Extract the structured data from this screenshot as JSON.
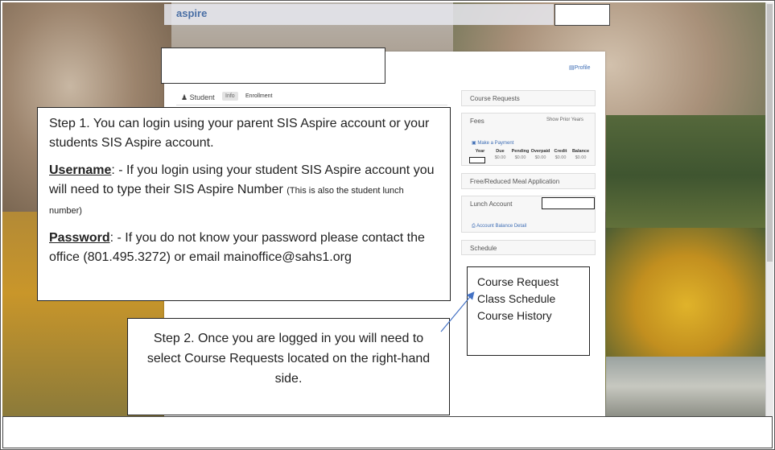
{
  "app": {
    "logo": "aspire",
    "profile_link": "Profile"
  },
  "tabs": {
    "student": "Student",
    "info": "Info",
    "enrollment": "Enrollment"
  },
  "sidebar": {
    "course_requests": "Course Requests",
    "fees": {
      "label": "Fees",
      "show_prior": "Show Prior Years",
      "make_payment": "Make a Payment",
      "columns": [
        "Year",
        "Due",
        "Pending",
        "Overpaid",
        "Credit",
        "Balance"
      ],
      "values": [
        "",
        "$0.00",
        "$0.00",
        "$0.00",
        "$0.00",
        "$0.00"
      ]
    },
    "meal_application": "Free/Reduced Meal Application",
    "lunch_account": {
      "label": "Lunch Account",
      "detail_link": "Account Balance Detail"
    },
    "schedule": "Schedule"
  },
  "step1": {
    "intro": "Step 1. You can login using your parent SIS Aspire account or your students SIS Aspire account.",
    "username_label": "Username",
    "username_text": ": - If you login using your student SIS Aspire account you will need to type their SIS Aspire Number",
    "username_note": "(This is also the student lunch number)",
    "password_label": "Password",
    "password_text": ": - If you do not know your password please contact the office (801.495.3272) or email mainoffice@sahs1.org"
  },
  "step2": {
    "text": "Step 2. Once you are logged in you will need to select Course Requests located on the right-hand side."
  },
  "options_list": [
    "Course Request",
    "Class Schedule",
    "Course History"
  ]
}
